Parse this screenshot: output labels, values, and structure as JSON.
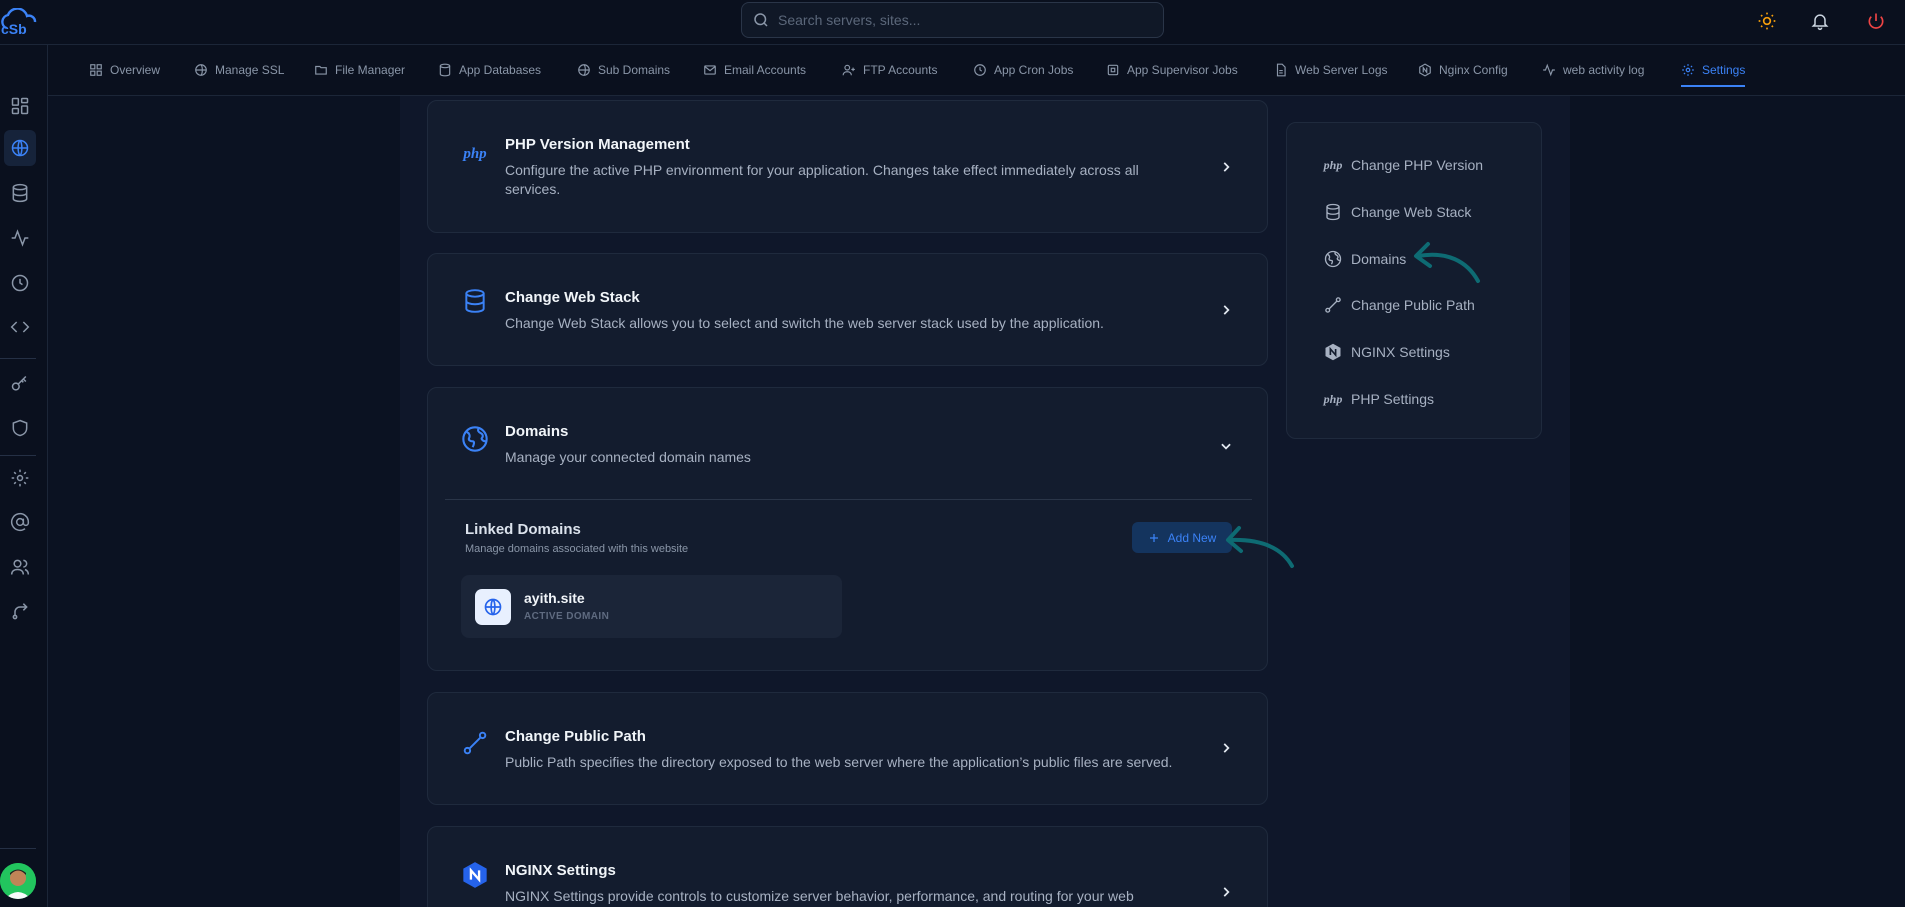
{
  "search": {
    "placeholder": "Search servers, sites..."
  },
  "tabs": [
    {
      "label": "Overview",
      "icon": "grid-icon"
    },
    {
      "label": "Manage SSL",
      "icon": "shield-icon"
    },
    {
      "label": "File Manager",
      "icon": "folder-icon"
    },
    {
      "label": "App Databases",
      "icon": "database-icon"
    },
    {
      "label": "Sub Domains",
      "icon": "globe-icon"
    },
    {
      "label": "Email Accounts",
      "icon": "mail-icon"
    },
    {
      "label": "FTP Accounts",
      "icon": "user-plus-icon"
    },
    {
      "label": "App Cron Jobs",
      "icon": "clock-icon"
    },
    {
      "label": "App Supervisor Jobs",
      "icon": "cpu-icon"
    },
    {
      "label": "Web Server Logs",
      "icon": "file-icon"
    },
    {
      "label": "Nginx Config",
      "icon": "nginx-icon"
    },
    {
      "label": "web activity log",
      "icon": "activity-icon"
    },
    {
      "label": "Settings",
      "icon": "gear-icon",
      "active": true
    }
  ],
  "cards": {
    "php": {
      "title": "PHP Version Management",
      "description": "Configure the active PHP environment for your application. Changes take effect immediately across all services.",
      "icon_text": "php"
    },
    "webstack": {
      "title": "Change Web Stack",
      "description": "Change Web Stack allows you to select and switch the web server stack used by the application."
    },
    "domains": {
      "title": "Domains",
      "description": "Manage your connected domain names",
      "linked_title": "Linked Domains",
      "linked_subtitle": "Manage domains associated with this website",
      "add_label": "Add New",
      "items": [
        {
          "name": "ayith.site",
          "status": "ACTIVE DOMAIN"
        }
      ]
    },
    "public_path": {
      "title": "Change Public Path",
      "description": "Public Path specifies the directory exposed to the web server where the application’s public files are served."
    },
    "nginx": {
      "title": "NGINX Settings",
      "description": "NGINX Settings provide controls to customize server behavior, performance, and routing for your web"
    }
  },
  "toc": [
    {
      "label": "Change PHP Version",
      "icon": "php-icon",
      "icon_text": "php"
    },
    {
      "label": "Change Web Stack",
      "icon": "database-icon"
    },
    {
      "label": "Domains",
      "icon": "globe-icon"
    },
    {
      "label": "Change Public Path",
      "icon": "path-icon"
    },
    {
      "label": "NGINX Settings",
      "icon": "nginx-icon"
    },
    {
      "label": "PHP Settings",
      "icon": "php-icon",
      "icon_text": "php"
    }
  ],
  "colors": {
    "accent": "#3b82f6",
    "annotation_arrow": "#0e6b73",
    "background": "#0b1222",
    "card": "#131c2e"
  }
}
